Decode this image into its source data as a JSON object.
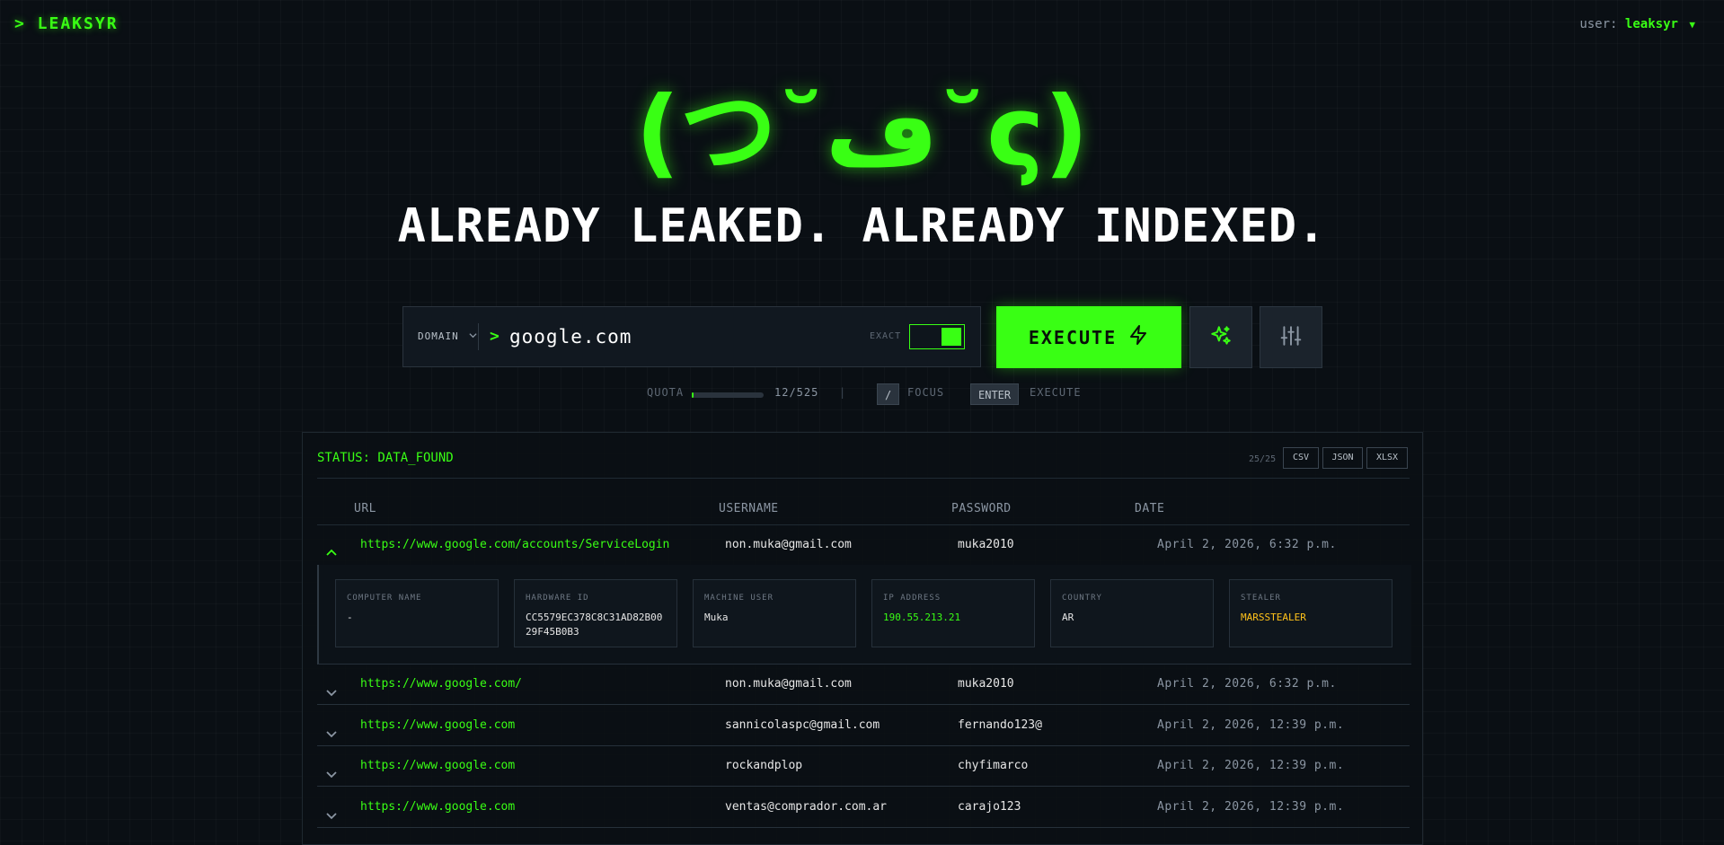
{
  "header": {
    "logo": "> LEAKSYR",
    "user_prefix": "user:",
    "username": "leaksyr",
    "user_caret": "▼"
  },
  "hero": {
    "face": "(つ˘ڡ˘ς)",
    "headline": "ALREADY LEAKED. ALREADY INDEXED."
  },
  "search": {
    "type_label": "DOMAIN",
    "prompt": ">",
    "value": "google.com",
    "exact_label": "EXACT",
    "exact_on": true,
    "execute_label": "EXECUTE"
  },
  "meta": {
    "quota_label": "QUOTA",
    "quota_text": "12/525",
    "quota_used": 12,
    "quota_total": 525,
    "divider": "|",
    "focus_key": "/",
    "focus_label": "FOCUS",
    "enter_key": "ENTER",
    "enter_label": "EXECUTE"
  },
  "results": {
    "status": "STATUS: DATA_FOUND",
    "count": "25/25",
    "exports": [
      "CSV",
      "JSON",
      "XLSX"
    ],
    "columns": {
      "url": "URL",
      "username": "USERNAME",
      "password": "PASSWORD",
      "date": "DATE"
    },
    "rows": [
      {
        "url": "https://www.google.com/accounts/ServiceLogin",
        "username": "non.muka@gmail.com",
        "password": "muka2010",
        "date": "April 2, 2026, 6:32 p.m.",
        "expanded": true
      },
      {
        "url": "https://www.google.com/",
        "username": "non.muka@gmail.com",
        "password": "muka2010",
        "date": "April 2, 2026, 6:32 p.m."
      },
      {
        "url": "https://www.google.com",
        "username": "sannicolaspc@gmail.com",
        "password": "fernando123@",
        "date": "April 2, 2026, 12:39 p.m."
      },
      {
        "url": "https://www.google.com",
        "username": "rockandplop",
        "password": "chyfimarco",
        "date": "April 2, 2026, 12:39 p.m."
      },
      {
        "url": "https://www.google.com",
        "username": "ventas@comprador.com.ar",
        "password": "carajo123",
        "date": "April 2, 2026, 12:39 p.m."
      }
    ],
    "detail": {
      "computer_name": {
        "label": "COMPUTER NAME",
        "value": "-"
      },
      "hardware_id": {
        "label": "HARDWARE ID",
        "value": "CC5579EC378C8C31AD82B0029F45B0B3"
      },
      "machine_user": {
        "label": "MACHINE USER",
        "value": "Muka"
      },
      "ip_address": {
        "label": "IP ADDRESS",
        "value": "190.55.213.21"
      },
      "country": {
        "label": "COUNTRY",
        "value": "AR"
      },
      "stealer": {
        "label": "STEALER",
        "value": "MARSSTEALER"
      }
    }
  },
  "colors": {
    "accent": "#39ff14",
    "background": "#0a0f14",
    "stealer": "#ffc21a"
  }
}
